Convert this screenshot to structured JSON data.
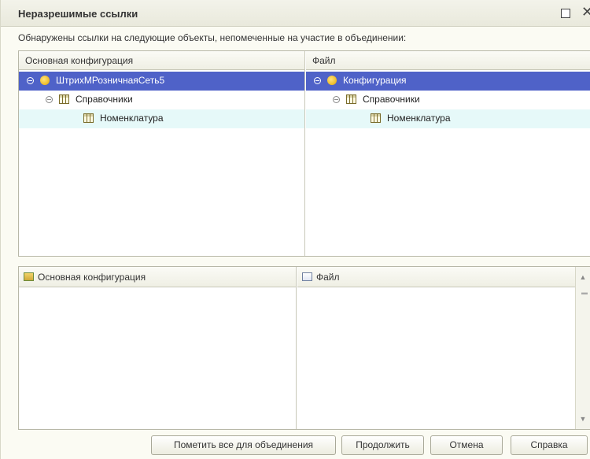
{
  "window": {
    "title": "Неразрешимые ссылки"
  },
  "message": "Обнаружены ссылки на следующие  объекты, непомеченные на участие в объединении:",
  "top_table": {
    "left_header": "Основная конфигурация",
    "right_header": "Файл",
    "left_rows": [
      {
        "label": "ШтрихМРозничнаяСеть5",
        "icon": "config-icon",
        "state": "selected"
      },
      {
        "label": "Справочники",
        "icon": "table-icon",
        "state": "normal"
      },
      {
        "label": "Номенклатура",
        "icon": "table-icon",
        "state": "highlight"
      }
    ],
    "right_rows": [
      {
        "label": "Конфигурация",
        "icon": "config-icon",
        "state": "selected"
      },
      {
        "label": "Справочники",
        "icon": "table-icon",
        "state": "normal"
      },
      {
        "label": "Номенклатура",
        "icon": "table-icon",
        "state": "highlight"
      }
    ]
  },
  "bottom_table": {
    "left_header": "Основная конфигурация",
    "right_header": "Файл"
  },
  "buttons": {
    "mark_all": "Пометить все для объединения",
    "continue": "Продолжить",
    "cancel": "Отмена",
    "help": "Справка"
  },
  "colors": {
    "selection": "#4f62c8",
    "highlight_row": "#e6f9f9",
    "window_bg": "#fbfbf3"
  }
}
